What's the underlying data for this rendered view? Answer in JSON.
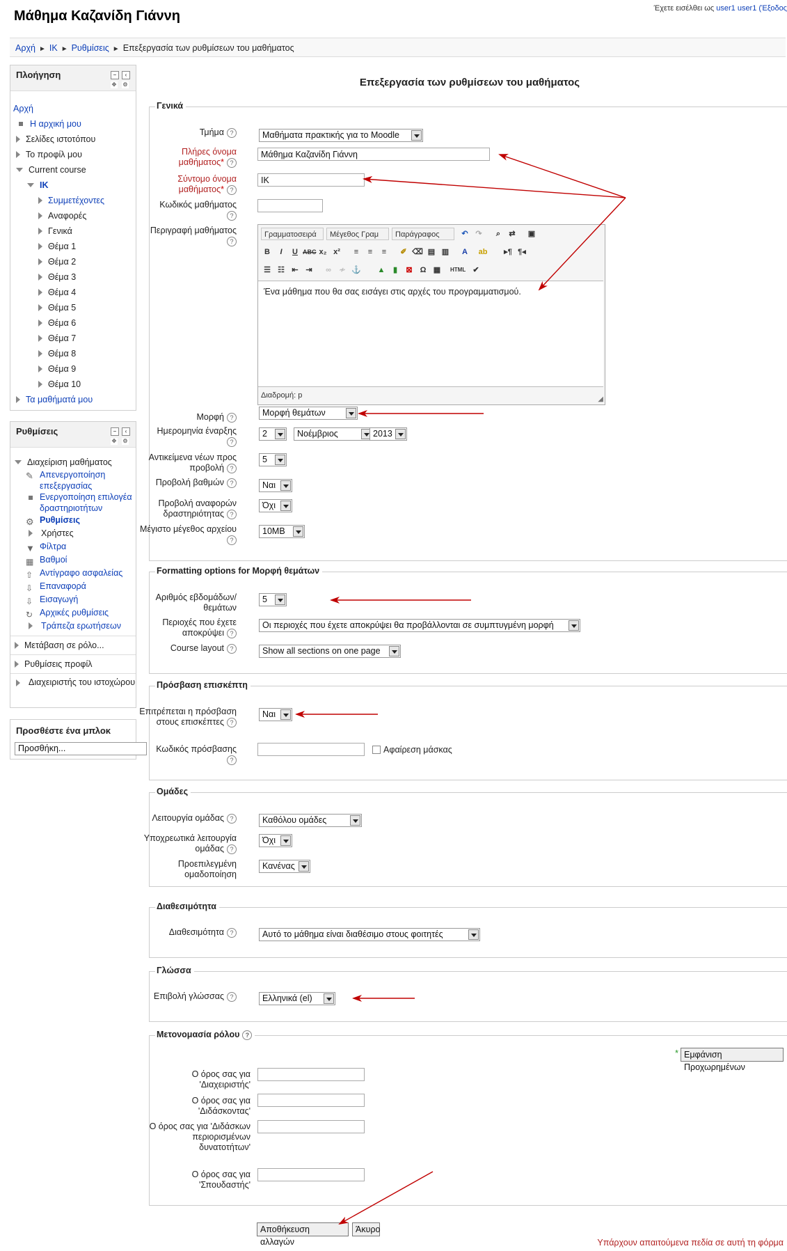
{
  "header": {
    "site_title": "Μάθημα Καζανίδη Γιάννη",
    "login_prefix": "Έχετε εισέλθει ως",
    "login_user": "user1 user1",
    "logout": "(Έξοδος"
  },
  "breadcrumb": [
    "Αρχή",
    "ΙΚ",
    "Ρυθμίσεις",
    "Επεξεργασία των ρυθμίσεων του μαθήματος"
  ],
  "navigation": {
    "title": "Πλοήγηση",
    "home": "Αρχή",
    "my_home": "Η αρχική μου",
    "site_pages": "Σελίδες ιστοτόπου",
    "my_profile": "Το προφίλ μου",
    "current_course": "Current course",
    "course_short": "ΙΚ",
    "participants": "Συμμετέχοντες",
    "reports": "Αναφορές",
    "general": "Γενικά",
    "topics": [
      "Θέμα 1",
      "Θέμα 2",
      "Θέμα 3",
      "Θέμα 4",
      "Θέμα 5",
      "Θέμα 6",
      "Θέμα 7",
      "Θέμα 8",
      "Θέμα 9",
      "Θέμα 10"
    ],
    "my_courses": "Τα μαθήματά μου"
  },
  "settings_block": {
    "title": "Ρυθμίσεις",
    "course_admin": "Διαχείριση μαθήματος",
    "disable_editing": "Απενεργοποίηση επεξεργασίας",
    "enable_activity_chooser": "Ενεργοποίηση επιλογέα δραστηριοτήτων",
    "settings": "Ρυθμίσεις",
    "users": "Χρήστες",
    "filters": "Φίλτρα",
    "grades": "Βαθμοί",
    "backup": "Αντίγραφο ασφαλείας",
    "restore": "Επαναφορά",
    "import": "Εισαγωγή",
    "reset": "Αρχικές ρυθμίσεις",
    "question_bank": "Τράπεζα ερωτήσεων",
    "switch_role": "Μετάβαση σε ρόλο...",
    "profile_settings": "Ρυθμίσεις προφίλ",
    "site_admin": "Διαχειριστής του ιστοχώρου"
  },
  "add_block": {
    "title": "Προσθέστε ένα μπλοκ",
    "select_value": "Προσθήκη..."
  },
  "page_heading": "Επεξεργασία των ρυθμίσεων του μαθήματος",
  "general": {
    "legend": "Γενικά",
    "category_label": "Τμήμα",
    "category_value": "Μαθήματα πρακτικής για το Moodle",
    "fullname_label": "Πλήρες όνομα μαθήματος",
    "fullname_value": "Μάθημα Καζανίδη Γιάννη",
    "shortname_label": "Σύντομο όνομα μαθήματος",
    "shortname_value": "ΙΚ",
    "idnumber_label": "Κωδικός μαθήματος",
    "idnumber_value": "",
    "summary_label": "Περιγραφή μαθήματος",
    "editor_font": "Γραμματοσειρά",
    "editor_size": "Μέγεθος Γραμ",
    "editor_format": "Παράγραφος",
    "summary_text": "Ένα μάθημα που θα σας εισάγει στις αρχές του προγραμματισμού.",
    "editor_path": "Διαδρομή: p",
    "format_label": "Μορφή",
    "format_value": "Μορφή θεμάτων",
    "startdate_label": "Ημερομηνία έναρξης",
    "start_day": "2",
    "start_month": "Νοέμβριος",
    "start_year": "2013",
    "newsitems_label": "Αντικείμενα νέων προς προβολή",
    "newsitems_value": "5",
    "showgrades_label": "Προβολή βαθμών",
    "showgrades_value": "Ναι",
    "showreports_label": "Προβολή αναφορών δραστηριότητας",
    "showreports_value": "Όχι",
    "maxbytes_label": "Μέγιστο μέγεθος αρχείου",
    "maxbytes_value": "10MB"
  },
  "formatting": {
    "legend": "Formatting options for Μορφή θεμάτων",
    "numsections_label": "Αριθμός εβδομάδων/ θεμάτων",
    "numsections_value": "5",
    "hidden_label": "Περιοχές που έχετε αποκρύψει",
    "hidden_value": "Οι περιοχές που έχετε αποκρύψει θα προβάλλονται σε συμπτυγμένη μορφή",
    "layout_label": "Course layout",
    "layout_value": "Show all sections on one page"
  },
  "guest": {
    "legend": "Πρόσβαση επισκέπτη",
    "allow_label": "Επιτρέπεται η πρόσβαση στους επισκέπτες",
    "allow_value": "Ναι",
    "password_label": "Κωδικός πρόσβασης",
    "unmask_label": "Αφαίρεση μάσκας"
  },
  "groups": {
    "legend": "Ομάδες",
    "groupmode_label": "Λειτουργία ομάδας",
    "groupmode_value": "Καθόλου ομάδες",
    "force_label": "Υποχρεωτικά λειτουργία ομάδας",
    "force_value": "Όχι",
    "default_label": "Προεπιλεγμένη ομαδοποίηση",
    "default_value": "Κανένας"
  },
  "availability": {
    "legend": "Διαθεσιμότητα",
    "label": "Διαθεσιμότητα",
    "value": "Αυτό το μάθημα είναι διαθέσιμο στους φοιτητές"
  },
  "language": {
    "legend": "Γλώσσα",
    "label": "Επιβολή γλώσσας",
    "value": "Ελληνικά (el)"
  },
  "role_rename": {
    "legend": "Μετονομασία ρόλου",
    "show_advanced": "Εμφάνιση Προχωρημένων",
    "manager_label": "Ο όρος σας για 'Διαχειριστής'",
    "teacher_label": "Ο όρος σας για 'Διδάσκοντας'",
    "noneditingteacher_label": "Ο όρος σας για 'Διδάσκων περιορισμένων δυνατοτήτων'",
    "student_label": "Ο όρος σας για 'Σπουδαστής'"
  },
  "actions": {
    "save": "Αποθήκευση αλλαγών",
    "cancel": "Άκυρο"
  },
  "footer_note": "Υπάρχουν απαιτούμενα πεδία σε αυτή τη φόρμα",
  "colors": {
    "link": "#0d3fb8",
    "required": "#b22222",
    "arrow": "#c00000"
  }
}
